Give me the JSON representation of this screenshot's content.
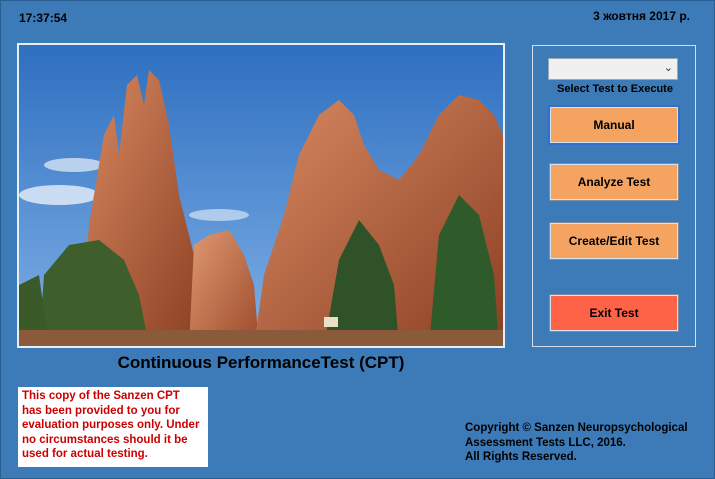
{
  "header": {
    "time": "17:37:54",
    "date": "3 жовтня 2017 р."
  },
  "main": {
    "title": "Continuous PerformanceTest (CPT)",
    "image_icon": "rock-formation-landscape"
  },
  "notice": {
    "lines": [
      "This copy of the Sanzen CPT",
      "has been provided to you for",
      "evaluation purposes only. Under",
      "no circumstances should it be",
      "used for actual testing."
    ]
  },
  "copyright": {
    "lines": [
      "Copyright © Sanzen Neuropsychological",
      "Assessment Tests LLC, 2016.",
      "All Rights Reserved."
    ]
  },
  "panel": {
    "select_value": "",
    "select_caption": "Select Test to Execute",
    "buttons": {
      "manual": "Manual",
      "analyze": "Analyze Test",
      "create_edit": "Create/Edit Test",
      "exit": "Exit Test"
    }
  },
  "colors": {
    "background": "#3c7ab8",
    "button": "#f4a460",
    "exit_button": "#ff6347",
    "notice_text": "#cc0000"
  }
}
